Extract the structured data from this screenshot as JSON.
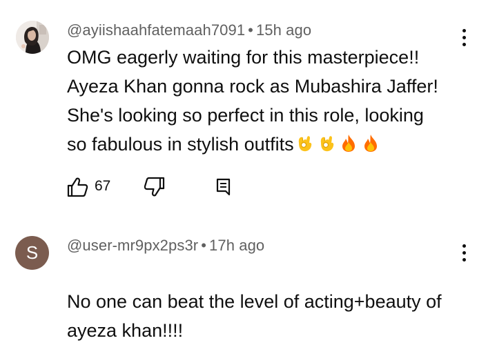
{
  "comments": [
    {
      "author": "@ayiishaahfatemaah7091",
      "time": "15h ago",
      "separator": "•",
      "avatar_icon": "profile-photo",
      "text": "OMG eagerly waiting for this masterpiece!!\nAyeza Khan gonna rock as Mubashira Jaffer!\nShe's looking so perfect in this role, looking\nso fabulous in stylish outfits",
      "emojis": [
        "ok-hand-emoji",
        "ok-hand-emoji",
        "fire-emoji",
        "fire-emoji"
      ],
      "likes": "67",
      "menu_icon": "more-vert-icon"
    },
    {
      "author": "@user-mr9px2ps3r",
      "time": "17h ago",
      "separator": "•",
      "avatar_letter": "S",
      "avatar_color": "#7b5c4f",
      "text": "No one can beat the level of acting+beauty of\nayeza khan!!!!",
      "menu_icon": "more-vert-icon"
    }
  ]
}
